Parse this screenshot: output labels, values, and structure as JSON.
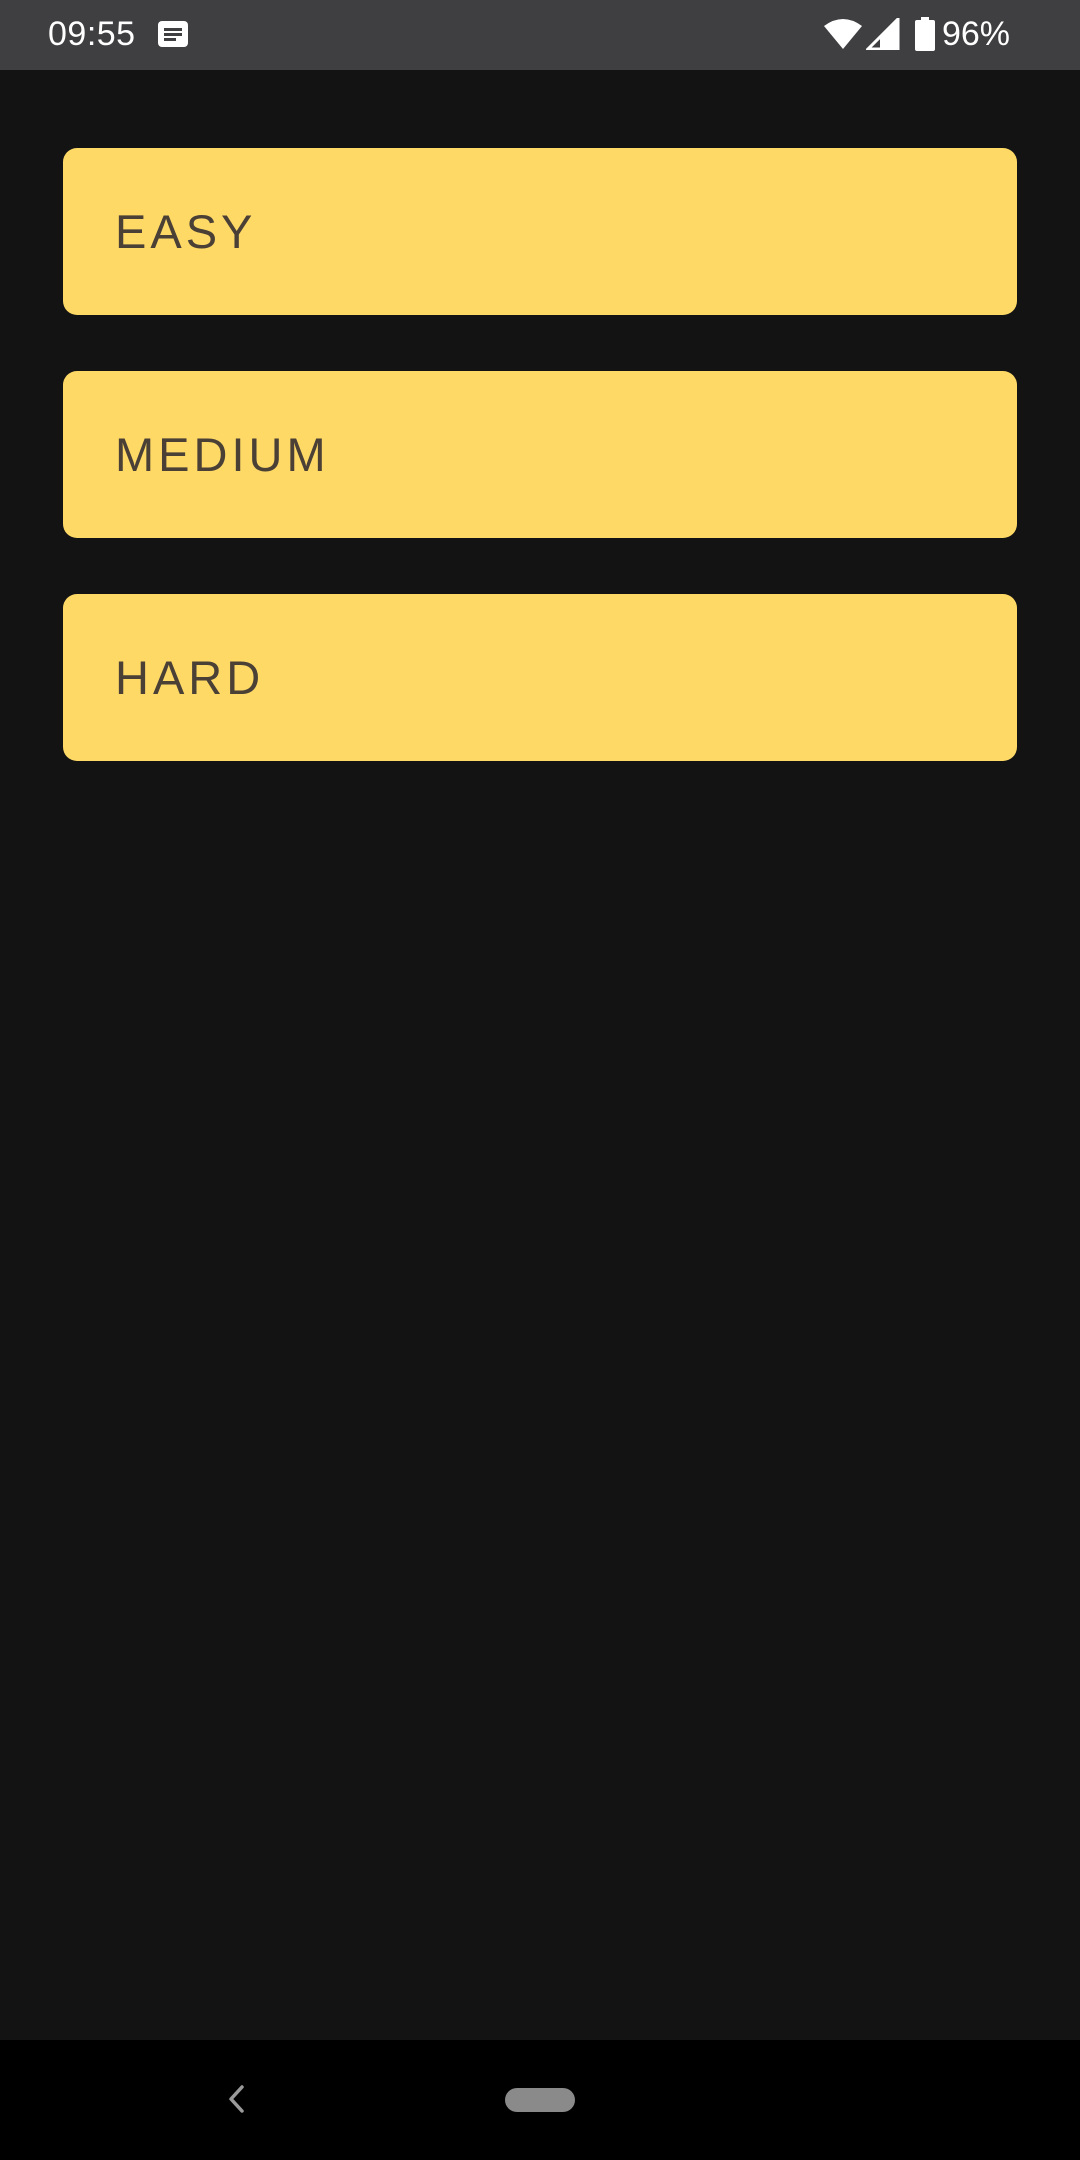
{
  "status_bar": {
    "time": "09:55",
    "battery_percent": "96%",
    "notification_icon": "message-notification-icon",
    "wifi_icon": "wifi-icon",
    "signal_icon": "cell-signal-icon",
    "battery_icon": "battery-icon"
  },
  "levels": [
    {
      "label": "EASY"
    },
    {
      "label": "MEDIUM"
    },
    {
      "label": "HARD"
    }
  ],
  "nav_bar": {
    "back_icon": "back-chevron-icon",
    "home_icon": "home-pill-icon"
  },
  "colors": {
    "background": "#131313",
    "status_bar": "#3f3e41",
    "button_fill": "#ffd966",
    "button_text": "#4a4036",
    "nav_bar": "#000000"
  }
}
